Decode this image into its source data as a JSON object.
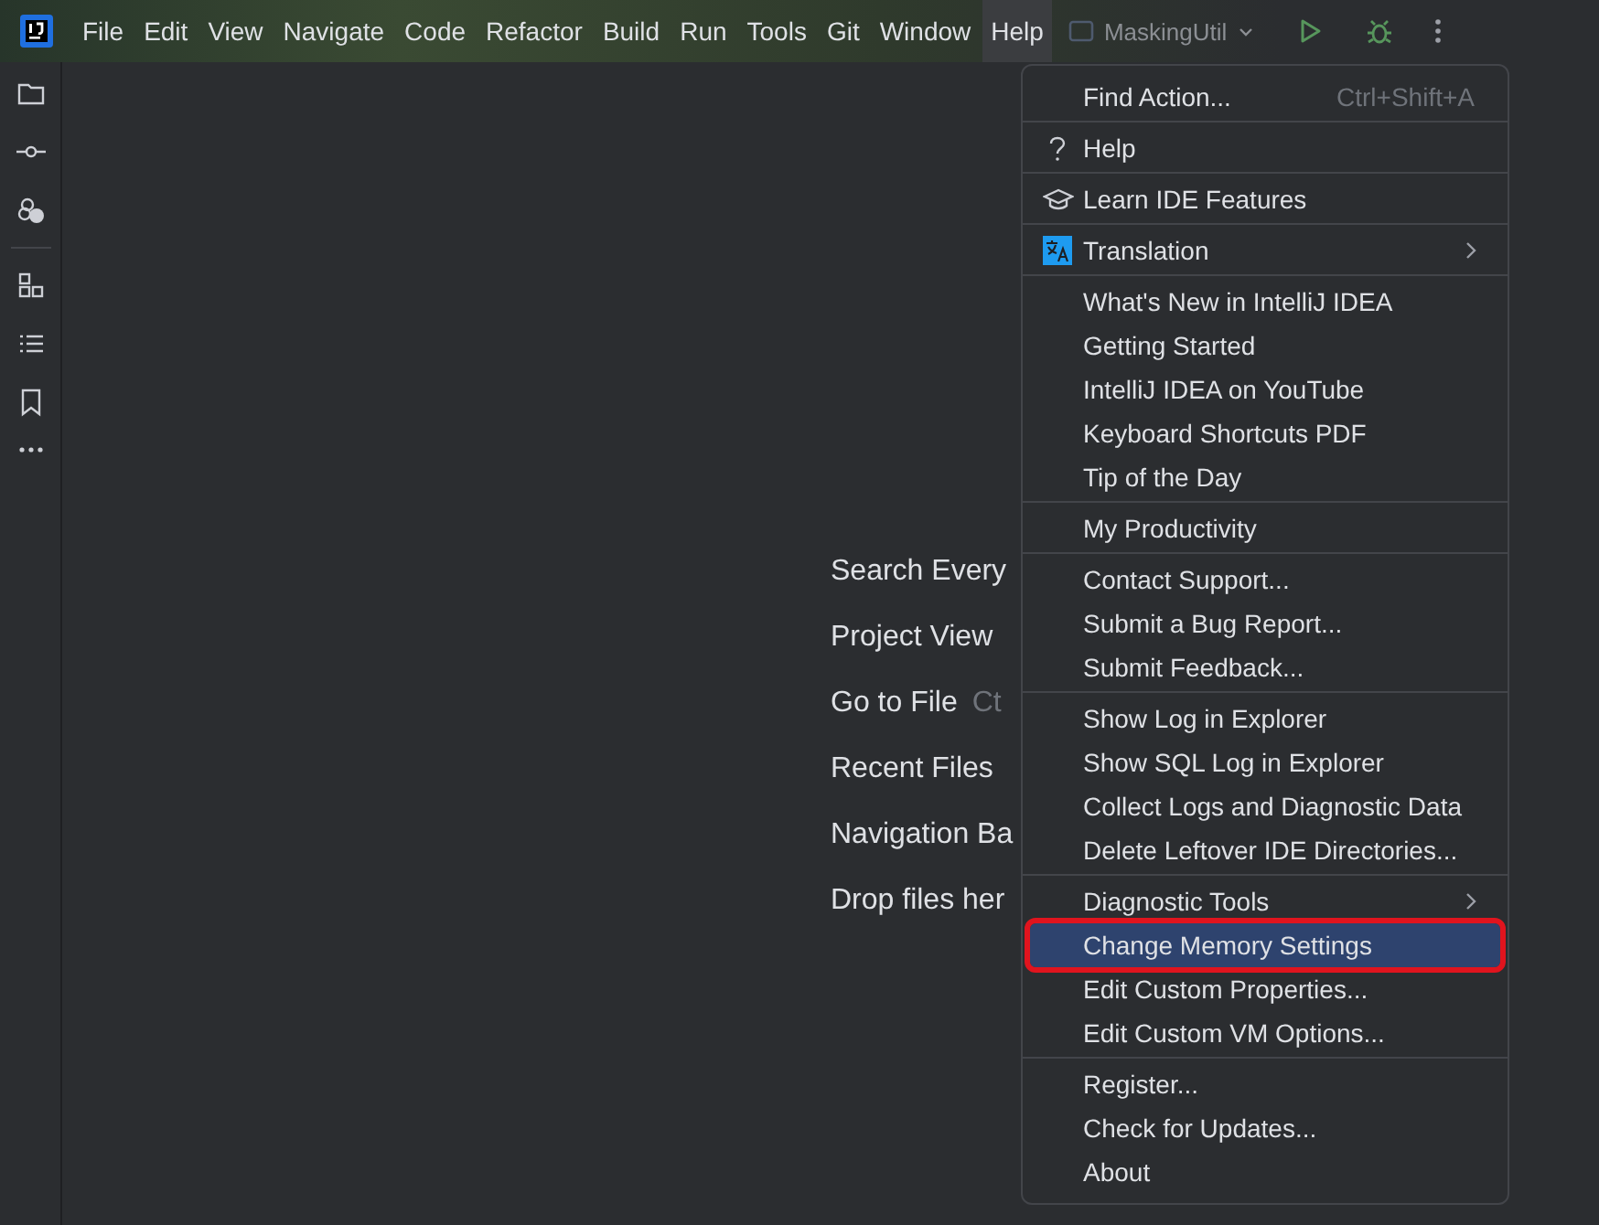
{
  "menu_bar": [
    {
      "label": "File",
      "selected": false
    },
    {
      "label": "Edit",
      "selected": false
    },
    {
      "label": "View",
      "selected": false
    },
    {
      "label": "Navigate",
      "selected": false
    },
    {
      "label": "Code",
      "selected": false
    },
    {
      "label": "Refactor",
      "selected": false
    },
    {
      "label": "Build",
      "selected": false
    },
    {
      "label": "Run",
      "selected": false
    },
    {
      "label": "Tools",
      "selected": false
    },
    {
      "label": "Git",
      "selected": false
    },
    {
      "label": "Window",
      "selected": false
    },
    {
      "label": "Help",
      "selected": true
    }
  ],
  "project_widget": {
    "label": "MaskingUtil"
  },
  "welcome_hints": [
    {
      "label": "Search Every"
    },
    {
      "label": "Project View"
    },
    {
      "label": "Go to File",
      "shortcut": "Ct"
    },
    {
      "label": "Recent Files"
    },
    {
      "label": "Navigation Ba"
    },
    {
      "label": "Drop files her"
    }
  ],
  "help_menu": {
    "groups": [
      [
        {
          "label": "Find Action...",
          "shortcut": "Ctrl+Shift+A",
          "selected": false
        }
      ],
      [
        {
          "label": "Help",
          "kind": "question",
          "selected": false
        }
      ],
      [
        {
          "label": "Learn IDE Features",
          "kind": "graduation",
          "selected": false
        }
      ],
      [
        {
          "label": "Translation",
          "kind": "translate",
          "submenu": true,
          "selected": false
        }
      ],
      [
        {
          "label": "What's New in IntelliJ IDEA",
          "selected": false
        },
        {
          "label": "Getting Started",
          "selected": false
        },
        {
          "label": "IntelliJ IDEA on YouTube",
          "selected": false
        },
        {
          "label": "Keyboard Shortcuts PDF",
          "selected": false
        },
        {
          "label": "Tip of the Day",
          "selected": false
        }
      ],
      [
        {
          "label": "My Productivity",
          "selected": false
        }
      ],
      [
        {
          "label": "Contact Support...",
          "selected": false
        },
        {
          "label": "Submit a Bug Report...",
          "selected": false
        },
        {
          "label": "Submit Feedback...",
          "selected": false
        }
      ],
      [
        {
          "label": "Show Log in Explorer",
          "selected": false
        },
        {
          "label": "Show SQL Log in Explorer",
          "selected": false
        },
        {
          "label": "Collect Logs and Diagnostic Data",
          "selected": false
        },
        {
          "label": "Delete Leftover IDE Directories...",
          "selected": false
        }
      ],
      [
        {
          "label": "Diagnostic Tools",
          "submenu": true,
          "selected": false
        },
        {
          "label": "Change Memory Settings",
          "selected": true,
          "highlighted": true
        },
        {
          "label": "Edit Custom Properties...",
          "selected": false
        },
        {
          "label": "Edit Custom VM Options...",
          "selected": false
        }
      ],
      [
        {
          "label": "Register...",
          "selected": false
        },
        {
          "label": "Check for Updates...",
          "selected": false
        },
        {
          "label": "About",
          "selected": false
        }
      ]
    ]
  }
}
